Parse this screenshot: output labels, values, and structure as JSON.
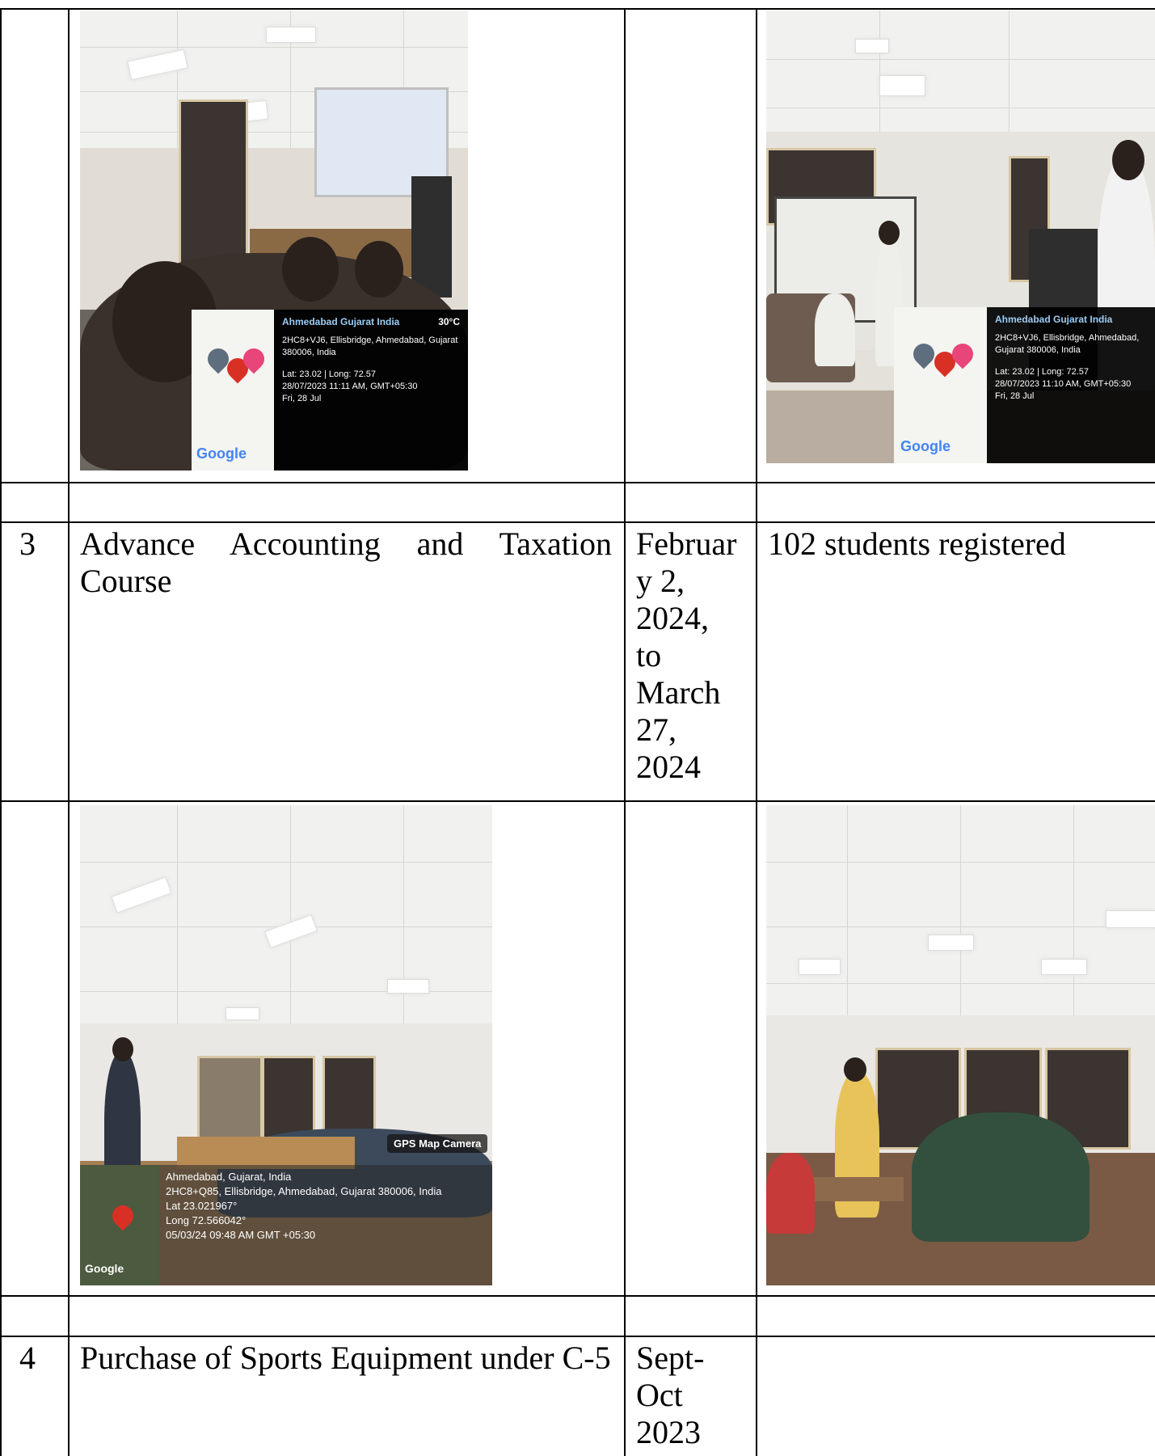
{
  "rows": [
    {
      "photos": [
        {
          "location_title": "Ahmedabad Gujarat India",
          "weather": "30°C",
          "address": "2HC8+VJ6, Ellisbridge, Ahmedabad, Gujarat 380006, India",
          "latlong": "Lat: 23.02 | Long: 72.57",
          "datetime": "28/07/2023 11:11 AM, GMT+05:30",
          "day": "Fri, 28 Jul",
          "brand": "Google"
        },
        {
          "location_title": "Ahmedabad Gujarat India",
          "address": "2HC8+VJ6, Ellisbridge, Ahmedabad, Gujarat 380006, India",
          "latlong": "Lat: 23.02 | Long: 72.57",
          "datetime": "28/07/2023 11:10 AM, GMT+05:30",
          "day": "Fri, 28 Jul",
          "brand": "Google"
        }
      ]
    },
    {
      "sr": "3",
      "program": "Advance Accounting and Taxation Course",
      "date": "Februar\ny 2,\n2024,\nto\nMarch\n27,\n2024",
      "details": "102 students registered"
    },
    {
      "photos": [
        {
          "gps_tag": "GPS Map Camera",
          "location_title": "Ahmedabad, Gujarat, India",
          "address": "2HC8+Q85, Ellisbridge, Ahmedabad, Gujarat 380006, India",
          "lat": "Lat 23.021967°",
          "long": "Long 72.566042°",
          "datetime": "05/03/24 09:48 AM GMT +05:30",
          "brand": "Google"
        }
      ]
    },
    {
      "sr": "4",
      "program": "Purchase of Sports Equipment under C-5",
      "date": "Sept-\nOct\n2023",
      "details": ""
    }
  ]
}
